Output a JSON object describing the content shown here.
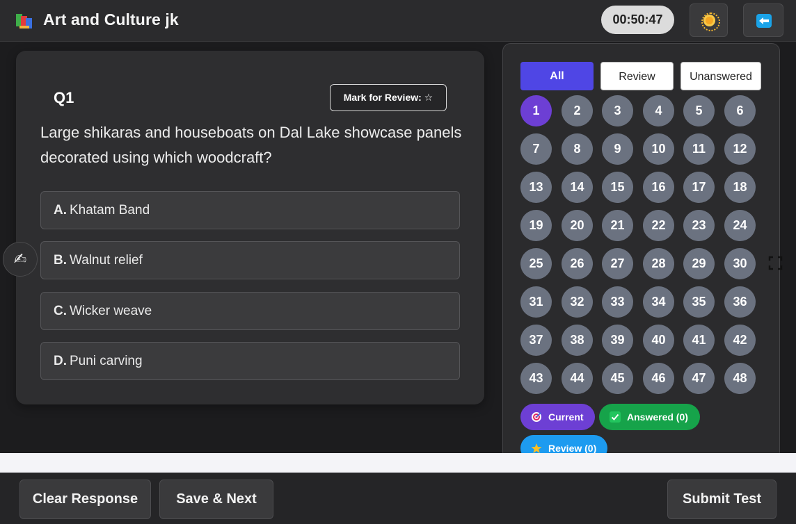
{
  "header": {
    "title": "Art and Culture jk",
    "timer": "00:50:47",
    "logo_icon": "books-icon",
    "theme_icon": "sun-icon",
    "exit_icon": "left-arrow-icon"
  },
  "question": {
    "number": "Q1",
    "review_label": "Mark for Review: ☆",
    "text": "Large shikaras and houseboats on Dal Lake showcase panels decorated using which woodcraft?",
    "options": [
      {
        "letter": "A.",
        "text": "Khatam Band"
      },
      {
        "letter": "B.",
        "text": "Walnut relief"
      },
      {
        "letter": "C.",
        "text": "Wicker weave"
      },
      {
        "letter": "D.",
        "text": "Puni carving"
      }
    ]
  },
  "side_tools": {
    "pen_icon": "✍"
  },
  "palette": {
    "filters": {
      "all": "All",
      "review": "Review",
      "unanswered": "Unanswered"
    },
    "current": 1,
    "count": 48,
    "legend": {
      "current": "Current",
      "answered": "Answered (0)",
      "review": "Review (0)"
    }
  },
  "footer": {
    "clear": "Clear Response",
    "save_next": "Save & Next",
    "submit": "Submit Test"
  },
  "colors": {
    "accent": "#4f46e5",
    "current": "#6d3fd4",
    "answered": "#16a34a",
    "review": "#1d9bf0",
    "unvisited": "#6b7280"
  }
}
